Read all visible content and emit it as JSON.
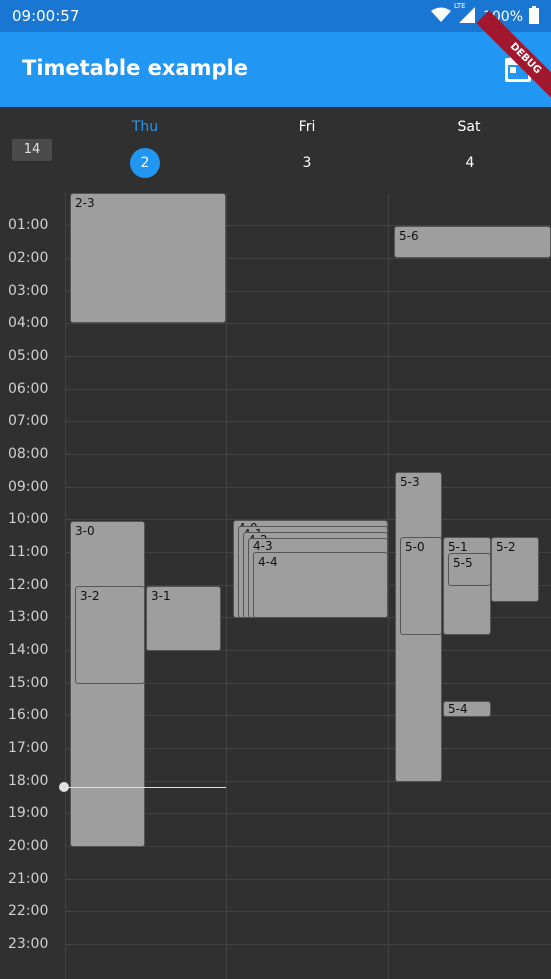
{
  "status": {
    "time": "09:00:57",
    "network": "LTE",
    "battery": "100%"
  },
  "appbar": {
    "title": "Timetable example",
    "debug_label": "DEBUG"
  },
  "header": {
    "week": "14",
    "days": [
      {
        "name": "Thu",
        "number": "2",
        "selected": true
      },
      {
        "name": "Fri",
        "number": "3",
        "selected": false
      },
      {
        "name": "Sat",
        "number": "4",
        "selected": false
      }
    ]
  },
  "hours": [
    "01:00",
    "02:00",
    "03:00",
    "04:00",
    "05:00",
    "06:00",
    "07:00",
    "08:00",
    "09:00",
    "10:00",
    "11:00",
    "12:00",
    "13:00",
    "14:00",
    "15:00",
    "16:00",
    "17:00",
    "18:00",
    "19:00",
    "20:00",
    "21:00",
    "22:00",
    "23:00"
  ],
  "events": {
    "e23": "2-3",
    "e30": "3-0",
    "e32": "3-2",
    "e31": "3-1",
    "e40": "4-0",
    "e41": "4-1",
    "e42": "4-2",
    "e43": "4-3",
    "e44": "4-4",
    "e56": "5-6",
    "e53": "5-3",
    "e50": "5-0",
    "e51": "5-1",
    "e55": "5-5",
    "e52": "5-2",
    "e54": "5-4"
  },
  "colors": {
    "accent": "#2196f3",
    "statusbar": "#1976d2",
    "background": "#303030",
    "event": "#9e9e9e"
  }
}
